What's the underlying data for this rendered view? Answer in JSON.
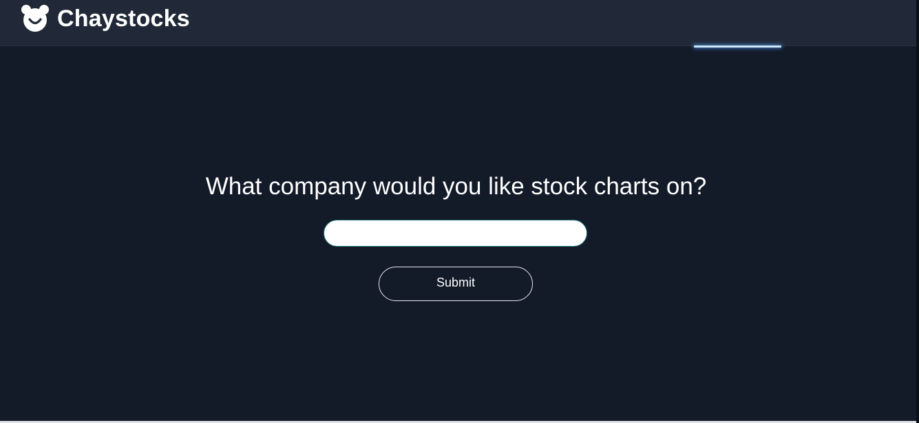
{
  "app": {
    "brand_name": "Chaystocks",
    "logo_icon": "bear-face-icon"
  },
  "main": {
    "question": "What company would you like stock charts on?",
    "company_input": {
      "value": "",
      "placeholder": ""
    },
    "submit_label": "Submit"
  },
  "colors": {
    "background": "#131a28",
    "navbar": "#212938",
    "text": "#ffffff",
    "nav_indicator": "#cfe6ff",
    "input_border": "#2a7f8a"
  }
}
